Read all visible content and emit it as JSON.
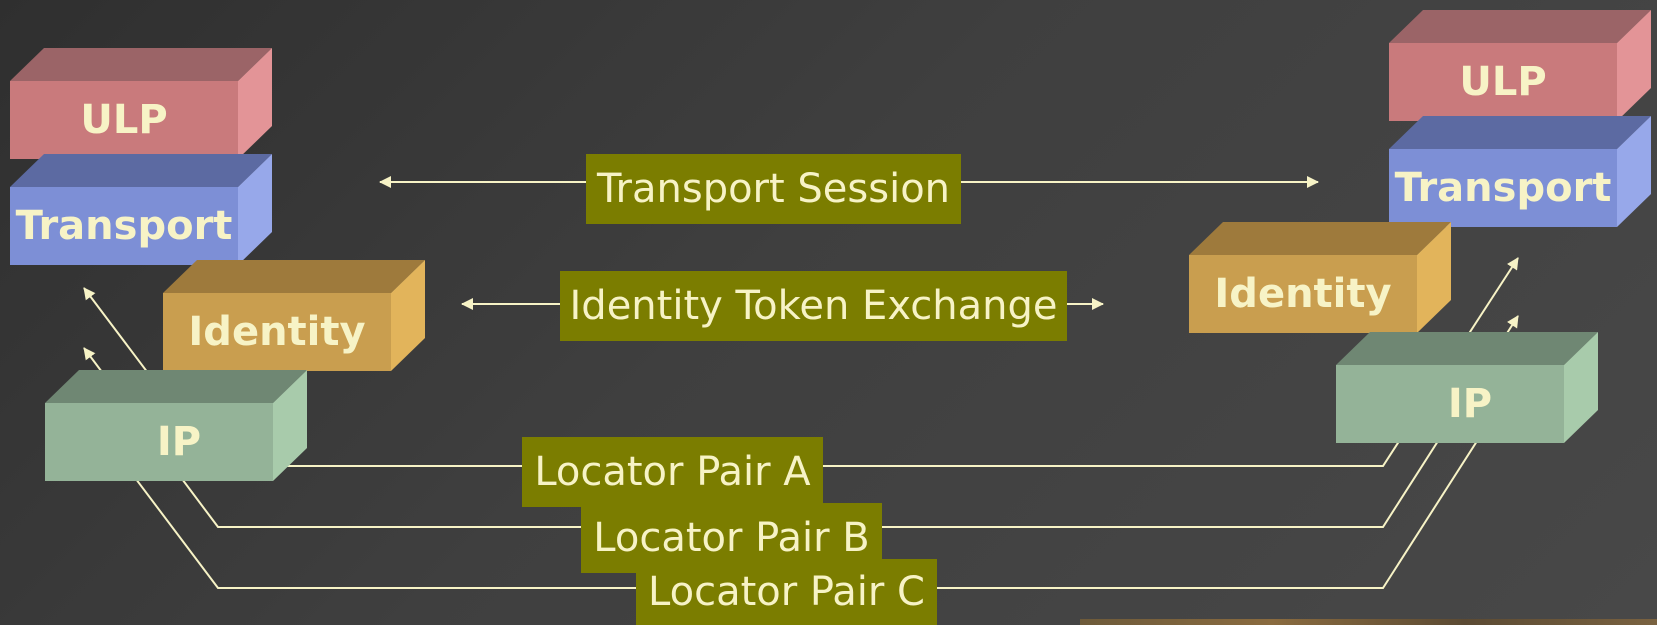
{
  "colors": {
    "ulp": "#c97a7c",
    "transport": "#7d8fd6",
    "identity": "#c99e4f",
    "ip": "#94b398",
    "label_bg": "#7b7d00",
    "text": "#f7f3c6",
    "line": "#f7f3c6"
  },
  "left_stack": {
    "ulp": "ULP",
    "transport": "Transport",
    "identity": "Identity",
    "ip": "IP"
  },
  "right_stack": {
    "ulp": "ULP",
    "transport": "Transport",
    "identity": "Identity",
    "ip": "IP"
  },
  "connections": {
    "transport_session": "Transport Session",
    "identity_token_exchange": "Identity Token Exchange",
    "locator_pair_a": "Locator Pair A",
    "locator_pair_b": "Locator Pair B",
    "locator_pair_c": "Locator Pair C"
  }
}
